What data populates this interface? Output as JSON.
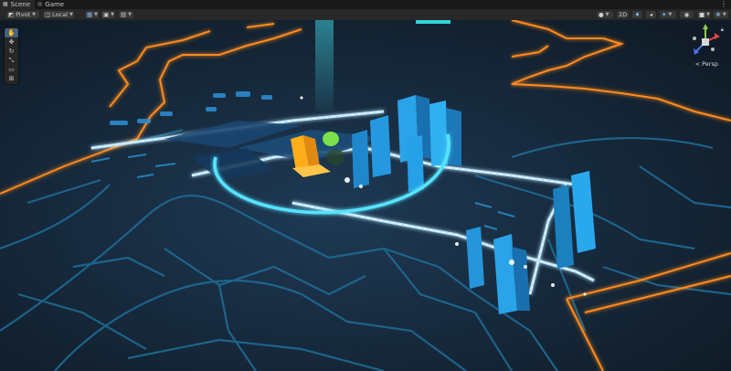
{
  "tabs": [
    {
      "label": "Scene",
      "icon": "scene-icon"
    },
    {
      "label": "Game",
      "icon": "game-icon"
    }
  ],
  "tab_menu": "⋮",
  "toolbar": {
    "pivot": "Pivot",
    "space": "Local",
    "mode_2d": "2D"
  },
  "gizmo": {
    "projection": "< Persp"
  },
  "tools": [
    "hand-tool",
    "move-tool",
    "rotate-tool",
    "scale-tool",
    "rect-tool",
    "transform-tool"
  ],
  "colors": {
    "background": "#162433",
    "road": "#1f6e98",
    "boundary": "#ff8a1c",
    "ring": "#57e3ff",
    "buildings": "#2aa3e8",
    "highlight": "#ffae1a",
    "marker": "#7be04a"
  }
}
